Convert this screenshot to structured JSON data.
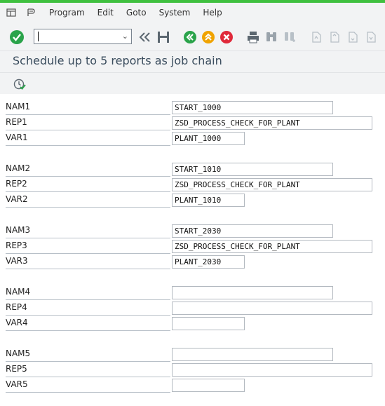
{
  "menubar": {
    "items": [
      "Program",
      "Edit",
      "Goto",
      "System",
      "Help"
    ]
  },
  "toolbar": {
    "command_value": "",
    "icons": [
      "enter-icon",
      "command-field",
      "back-double-icon",
      "save-icon",
      "back-icon",
      "exit-icon",
      "cancel-icon",
      "print-icon",
      "find-icon",
      "find-next-icon",
      "first-page-icon",
      "prev-page-icon",
      "next-page-icon",
      "last-page-icon"
    ],
    "colors": {
      "enter": "#2aa34a",
      "back": "#2aa34a",
      "exit": "#f0a300",
      "cancel": "#e0293a"
    }
  },
  "title": "Schedule up to 5 reports as job chain",
  "form": {
    "groups": [
      {
        "nam_label": "NAM1",
        "nam_value": "START_1000",
        "rep_label": "REP1",
        "rep_value": "ZSD_PROCESS_CHECK_FOR_PLANT",
        "var_label": "VAR1",
        "var_value": "PLANT_1000"
      },
      {
        "nam_label": "NAM2",
        "nam_value": "START_1010",
        "rep_label": "REP2",
        "rep_value": "ZSD_PROCESS_CHECK_FOR_PLANT",
        "var_label": "VAR2",
        "var_value": "PLANT_1010"
      },
      {
        "nam_label": "NAM3",
        "nam_value": "START_2030",
        "rep_label": "REP3",
        "rep_value": "ZSD_PROCESS_CHECK_FOR_PLANT",
        "var_label": "VAR3",
        "var_value": "PLANT_2030"
      },
      {
        "nam_label": "NAM4",
        "nam_value": "",
        "rep_label": "REP4",
        "rep_value": "",
        "var_label": "VAR4",
        "var_value": ""
      },
      {
        "nam_label": "NAM5",
        "nam_value": "",
        "rep_label": "REP5",
        "rep_value": "",
        "var_label": "VAR5",
        "var_value": ""
      }
    ]
  }
}
